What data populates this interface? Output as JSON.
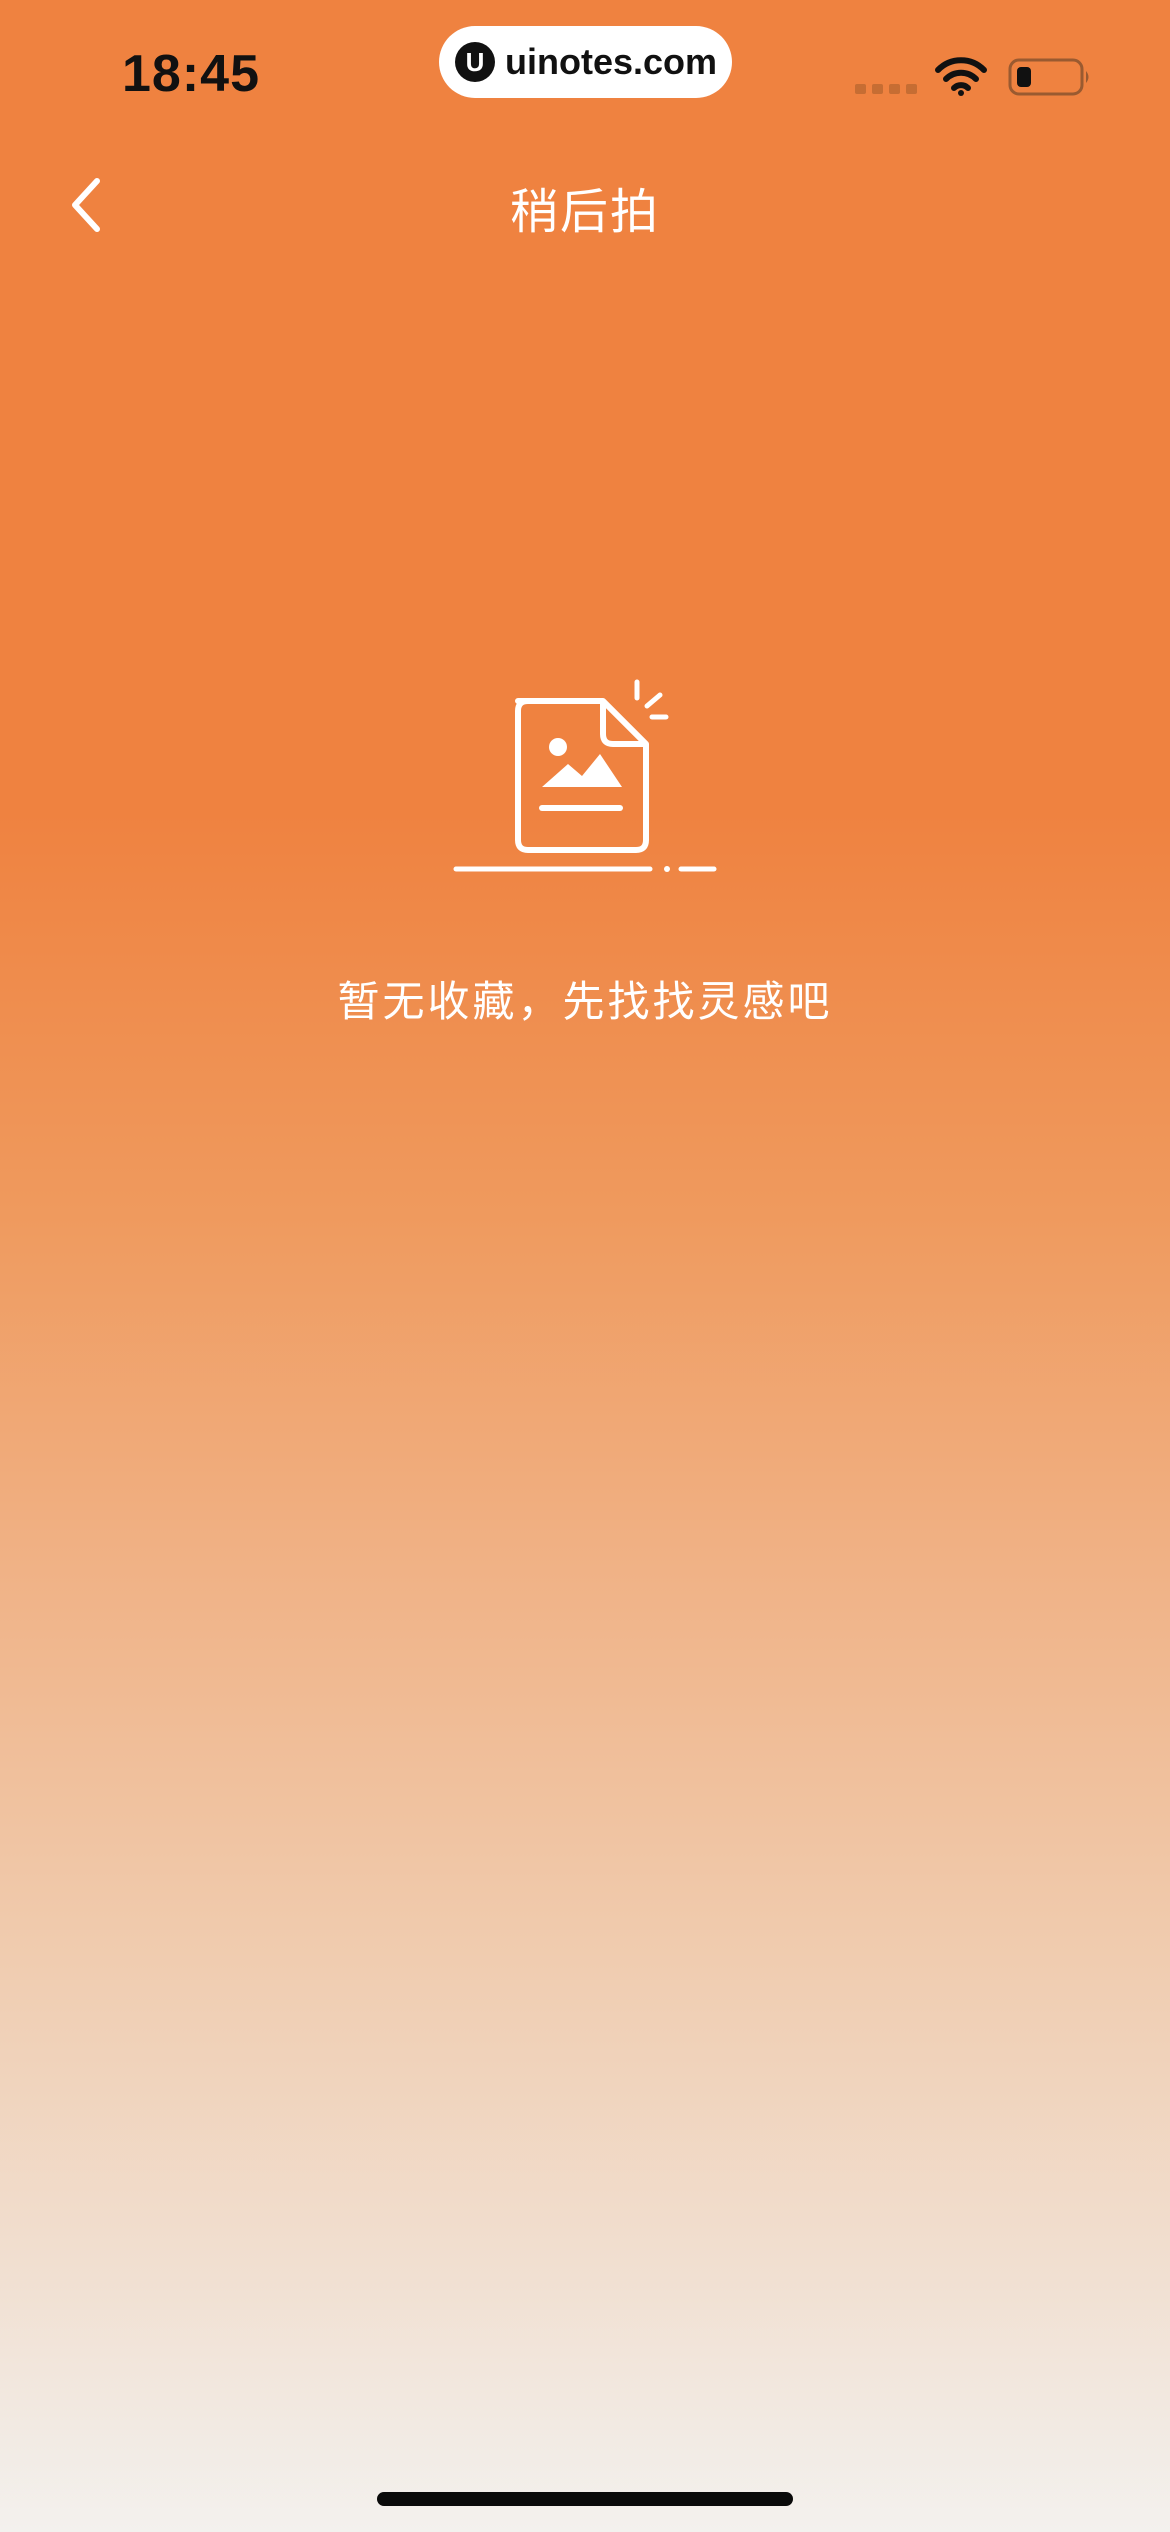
{
  "status_bar": {
    "time": "18:45",
    "watermark": "uinotes.com",
    "watermark_logo": "U"
  },
  "nav": {
    "title": "稍后拍",
    "back_icon": "chevron-left-icon"
  },
  "empty_state": {
    "icon": "empty-image-document-icon",
    "message": "暂无收藏，先找找灵感吧"
  },
  "colors": {
    "accent": "#EF8240",
    "text_on_accent": "#FFFFFF",
    "bottom_fade": "#F3F1EE"
  }
}
